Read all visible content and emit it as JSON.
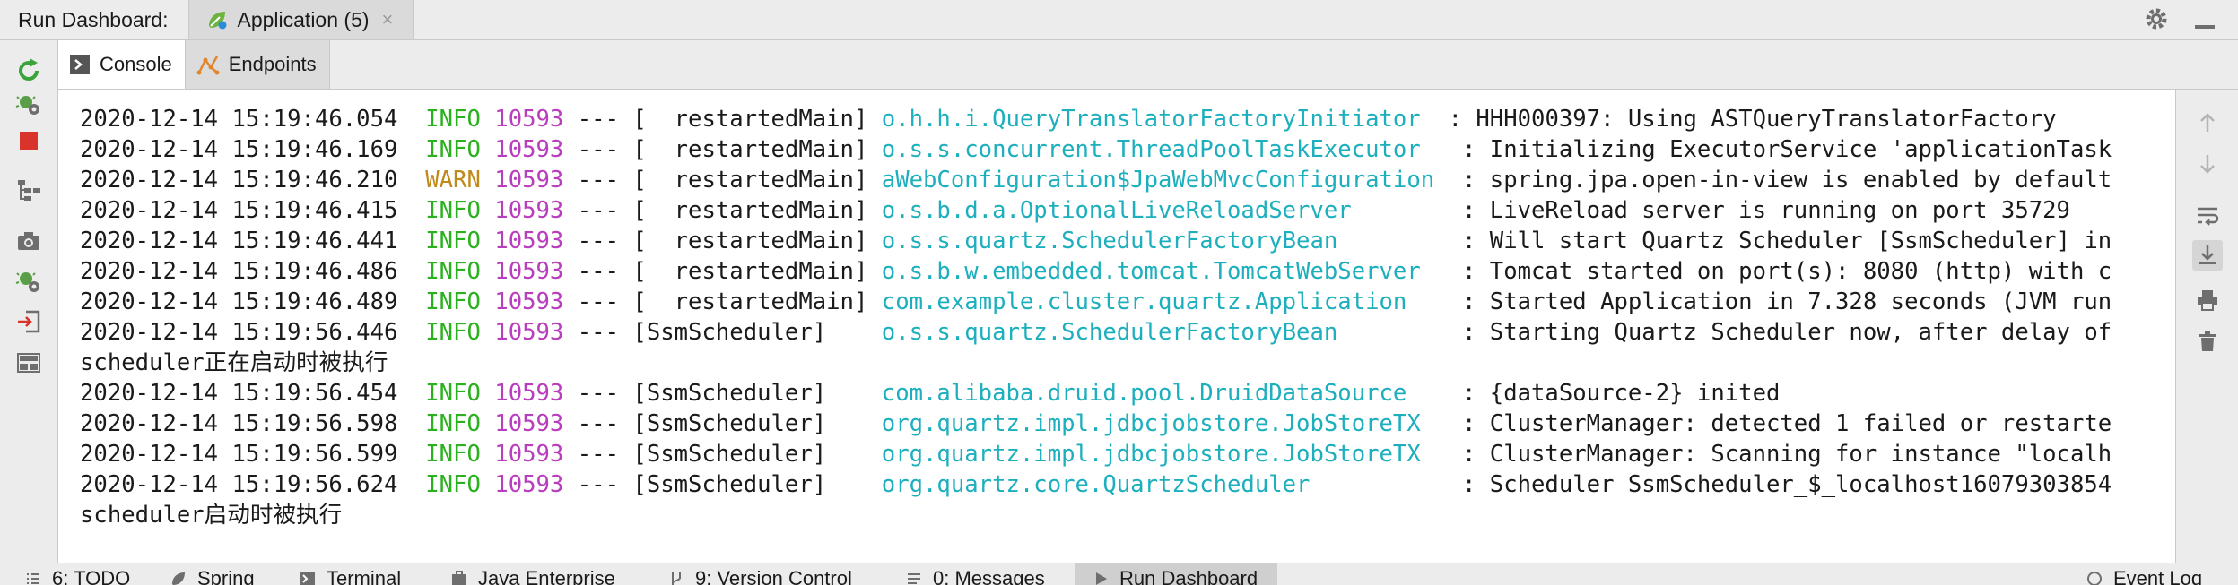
{
  "header": {
    "title": "Run Dashboard:",
    "tab_label": "Application (5)",
    "close_glyph": "×"
  },
  "subtabs": [
    {
      "label": "Console",
      "icon": "console-icon"
    },
    {
      "label": "Endpoints",
      "icon": "endpoints-icon"
    }
  ],
  "log_lines": [
    {
      "ts": "2020-12-14 15:19:46.054",
      "level": "INFO",
      "pid": "10593",
      "sep": "---",
      "thread": "[  restartedMain]",
      "logger": "o.h.h.i.QueryTranslatorFactoryInitiator ",
      "msg": ": HHH000397: Using ASTQueryTranslatorFactory"
    },
    {
      "ts": "2020-12-14 15:19:46.169",
      "level": "INFO",
      "pid": "10593",
      "sep": "---",
      "thread": "[  restartedMain]",
      "logger": "o.s.s.concurrent.ThreadPoolTaskExecutor  ",
      "msg": ": Initializing ExecutorService 'applicationTask"
    },
    {
      "ts": "2020-12-14 15:19:46.210",
      "level": "WARN",
      "pid": "10593",
      "sep": "---",
      "thread": "[  restartedMain]",
      "logger": "aWebConfiguration$JpaWebMvcConfiguration ",
      "msg": ": spring.jpa.open-in-view is enabled by default"
    },
    {
      "ts": "2020-12-14 15:19:46.415",
      "level": "INFO",
      "pid": "10593",
      "sep": "---",
      "thread": "[  restartedMain]",
      "logger": "o.s.b.d.a.OptionalLiveReloadServer       ",
      "msg": ": LiveReload server is running on port 35729"
    },
    {
      "ts": "2020-12-14 15:19:46.441",
      "level": "INFO",
      "pid": "10593",
      "sep": "---",
      "thread": "[  restartedMain]",
      "logger": "o.s.s.quartz.SchedulerFactoryBean        ",
      "msg": ": Will start Quartz Scheduler [SsmScheduler] in"
    },
    {
      "ts": "2020-12-14 15:19:46.486",
      "level": "INFO",
      "pid": "10593",
      "sep": "---",
      "thread": "[  restartedMain]",
      "logger": "o.s.b.w.embedded.tomcat.TomcatWebServer  ",
      "msg": ": Tomcat started on port(s): 8080 (http) with c"
    },
    {
      "ts": "2020-12-14 15:19:46.489",
      "level": "INFO",
      "pid": "10593",
      "sep": "---",
      "thread": "[  restartedMain]",
      "logger": "com.example.cluster.quartz.Application   ",
      "msg": ": Started Application in 7.328 seconds (JVM run"
    },
    {
      "ts": "2020-12-14 15:19:56.446",
      "level": "INFO",
      "pid": "10593",
      "sep": "---",
      "thread": "[SsmScheduler]",
      "logger": "o.s.s.quartz.SchedulerFactoryBean        ",
      "msg": ": Starting Quartz Scheduler now, after delay of"
    },
    {
      "plain": "scheduler正在启动时被执行"
    },
    {
      "ts": "2020-12-14 15:19:56.454",
      "level": "INFO",
      "pid": "10593",
      "sep": "---",
      "thread": "[SsmScheduler]",
      "logger": "com.alibaba.druid.pool.DruidDataSource   ",
      "msg": ": {dataSource-2} inited"
    },
    {
      "ts": "2020-12-14 15:19:56.598",
      "level": "INFO",
      "pid": "10593",
      "sep": "---",
      "thread": "[SsmScheduler]",
      "logger": "org.quartz.impl.jdbcjobstore.JobStoreTX  ",
      "msg": ": ClusterManager: detected 1 failed or restarte"
    },
    {
      "ts": "2020-12-14 15:19:56.599",
      "level": "INFO",
      "pid": "10593",
      "sep": "---",
      "thread": "[SsmScheduler]",
      "logger": "org.quartz.impl.jdbcjobstore.JobStoreTX  ",
      "msg": ": ClusterManager: Scanning for instance \"localh"
    },
    {
      "ts": "2020-12-14 15:19:56.624",
      "level": "INFO",
      "pid": "10593",
      "sep": "---",
      "thread": "[SsmScheduler]",
      "logger": "org.quartz.core.QuartzScheduler          ",
      "msg": ": Scheduler SsmScheduler_$_localhost16079303854"
    },
    {
      "plain": "scheduler启动时被执行"
    }
  ],
  "colors": {
    "info": "#2bb01f",
    "warn": "#c08a1a",
    "pid": "#b83ebd",
    "logger": "#1dafbd"
  },
  "bottom_tabs": [
    {
      "label": "6: TODO",
      "icon": "todo-icon"
    },
    {
      "label": "Spring",
      "icon": "spring-icon"
    },
    {
      "label": "Terminal",
      "icon": "terminal-icon"
    },
    {
      "label": "Java Enterprise",
      "icon": "java-enterprise-icon"
    },
    {
      "label": "9: Version Control",
      "icon": "version-control-icon"
    },
    {
      "label": "0: Messages",
      "icon": "messages-icon"
    },
    {
      "label": "Run Dashboard",
      "icon": "run-icon",
      "active": true
    },
    {
      "label": "Event Log",
      "icon": "event-log-icon"
    }
  ]
}
